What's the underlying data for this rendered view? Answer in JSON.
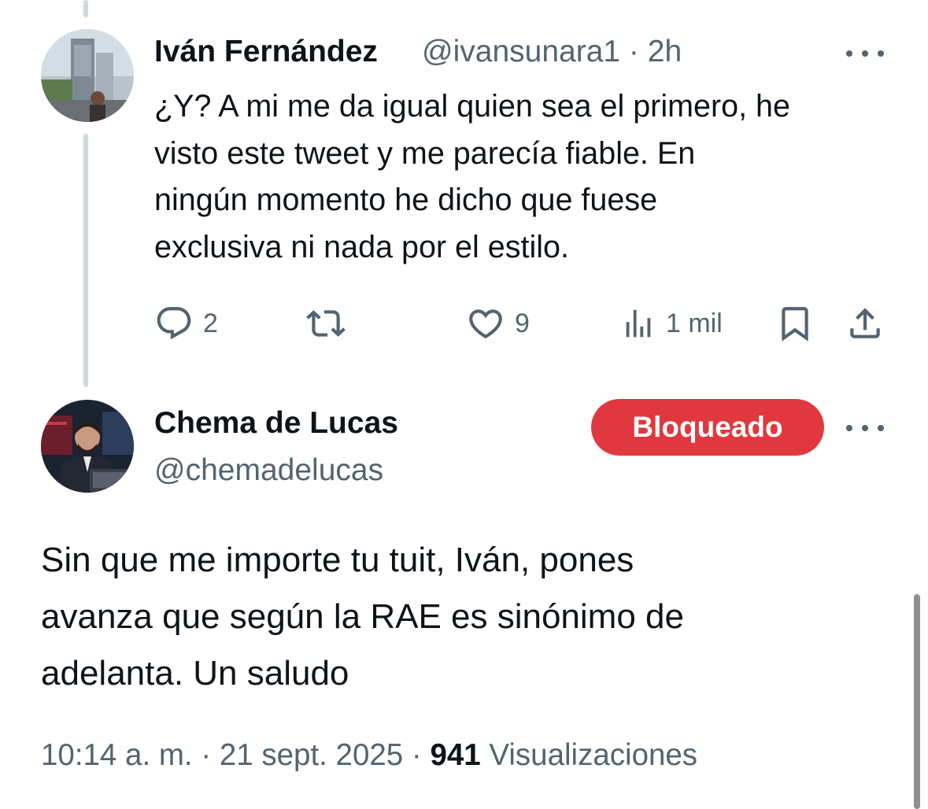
{
  "reply_tweet": {
    "display_name": "Iván Fernández",
    "handle": "@ivansunara1",
    "separator": "·",
    "time_ago": "2h",
    "body": "¿Y? A mi me da igual quien sea el primero, he\nvisto este tweet y me parecía fiable. En\nningún momento he dicho que fuese\nexclusiva ni nada por el estilo.",
    "actions": {
      "replies": "2",
      "retweets": "",
      "likes": "9",
      "views": "1 mil"
    },
    "icons": [
      "reply-icon",
      "retweet-icon",
      "like-icon",
      "views-icon",
      "bookmark-icon",
      "share-icon",
      "more-icon"
    ]
  },
  "main_tweet": {
    "display_name": "Chema de Lucas",
    "handle": "@chemadelucas",
    "blocked_label": "Bloqueado",
    "body": "Sin que me importe tu tuit, Iván, pones\navanza que según la RAE es sinónimo de\nadelanta. Un saludo",
    "meta": {
      "time": "10:14 a. m.",
      "date": "21 sept. 2025",
      "separator": "·",
      "views_count": "941",
      "views_label": "Visualizaciones"
    }
  },
  "colors": {
    "text_primary": "#0f1419",
    "text_secondary": "#536471",
    "blocked_red": "#e0383e",
    "thread_line": "#cfd9de"
  }
}
